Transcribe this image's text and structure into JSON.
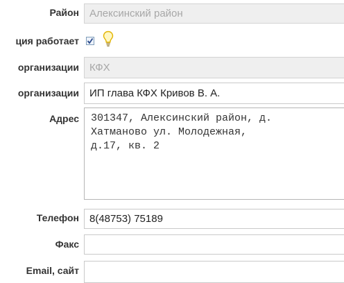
{
  "form": {
    "district": {
      "label": "Район",
      "value": "Алексинский район"
    },
    "works": {
      "label": "ция работает",
      "checked": true
    },
    "org_type": {
      "label": "организации",
      "value": "КФХ"
    },
    "org_name": {
      "label": "организации",
      "value": "ИП глава КФХ Кривов В. А."
    },
    "address": {
      "label": "Адрес",
      "value": "301347, Алексинский район, д.\nХатманово ул. Молодежная,\nд.17, кв. 2"
    },
    "phone": {
      "label": "Телефон",
      "value": "8(48753) 75189"
    },
    "fax": {
      "label": "Факс",
      "value": ""
    },
    "email": {
      "label": "Email, сайт",
      "value": ""
    }
  },
  "icons": {
    "checkbox": "checkmark-icon",
    "hint": "lightbulb-icon"
  },
  "colors": {
    "disabled_bg": "#efefef",
    "border": "#c9c9c9",
    "bulb": "#f2c200"
  }
}
